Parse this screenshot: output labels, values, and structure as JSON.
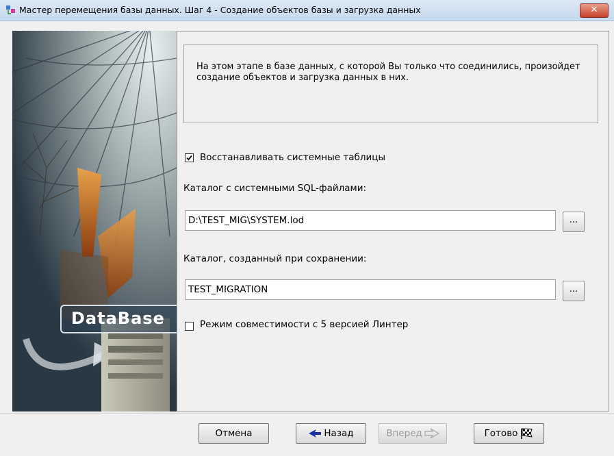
{
  "window": {
    "title": "Мастер перемещения базы данных. Шаг 4 - Создание объектов базы и загрузка данных",
    "close_label": "✕"
  },
  "sidebar_image": {
    "logo_text": "DataBase"
  },
  "info": {
    "text": "На этом этапе в базе данных, с которой Вы только что соединились, произойдет создание объектов и загрузка данных в них."
  },
  "restore_tables": {
    "label": "Восстанавливать системные таблицы",
    "checked": true
  },
  "sql_catalog": {
    "label": "Каталог с системными SQL-файлами:",
    "value": "D:\\TEST_MIG\\SYSTEM.lod",
    "browse_label": "..."
  },
  "saved_catalog": {
    "label": "Каталог, созданный при сохранении:",
    "value": "TEST_MIGRATION",
    "browse_label": "..."
  },
  "compat_mode": {
    "label": "Режим совместимости с 5 версией Линтер",
    "checked": false
  },
  "buttons": {
    "cancel": "Отмена",
    "back": "Назад",
    "next": "Вперед",
    "finish": "Готово"
  },
  "colors": {
    "accent_arrow": "#1a2fa0",
    "close_red": "#c8412b"
  }
}
